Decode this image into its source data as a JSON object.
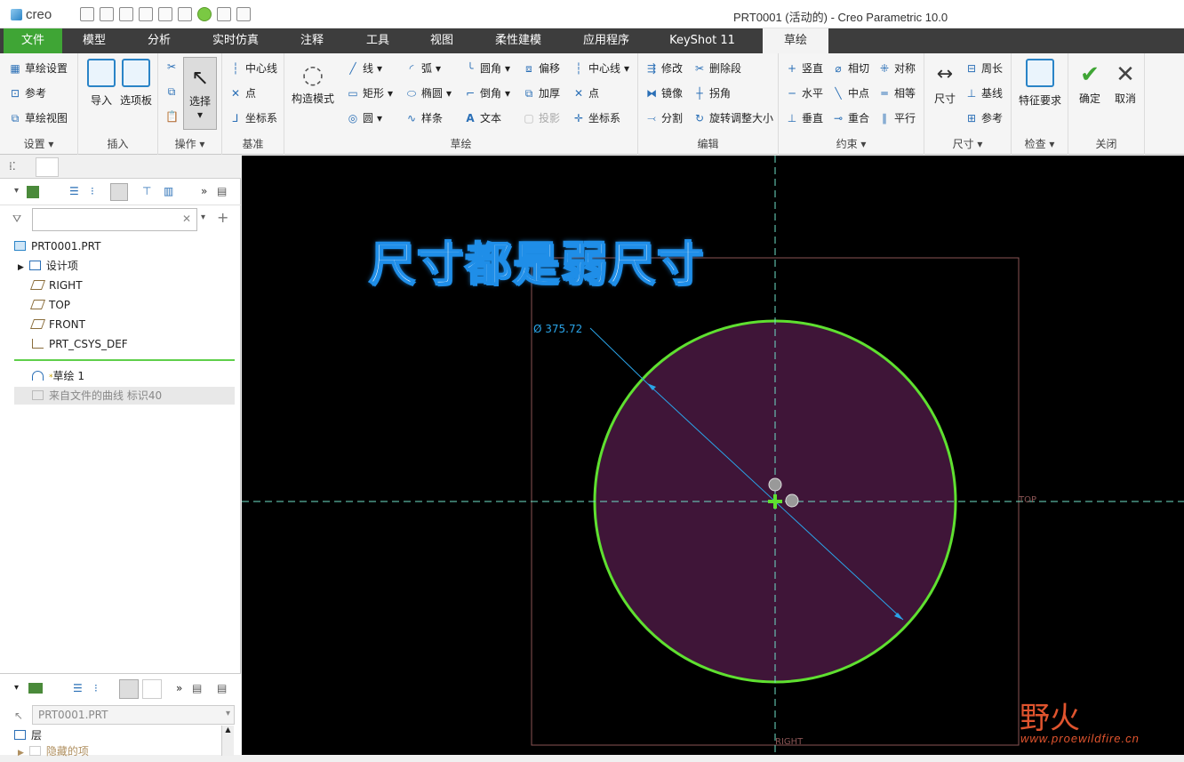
{
  "app": {
    "logo_text": "creo",
    "window_title": "PRT0001 (活动的) - Creo Parametric 10.0"
  },
  "tabs": [
    {
      "label": "文件"
    },
    {
      "label": "模型"
    },
    {
      "label": "分析"
    },
    {
      "label": "实时仿真"
    },
    {
      "label": "注释"
    },
    {
      "label": "工具"
    },
    {
      "label": "视图"
    },
    {
      "label": "柔性建模"
    },
    {
      "label": "应用程序"
    },
    {
      "label": "KeyShot 11"
    },
    {
      "label": "草绘"
    }
  ],
  "ribbon": {
    "setup": {
      "items": [
        "草绘设置",
        "参考",
        "草绘视图"
      ],
      "label": "设置"
    },
    "insert": {
      "items": [
        "导入",
        "选项板"
      ],
      "label": "插入"
    },
    "operations": {
      "select": "选择",
      "label": "操作"
    },
    "datum": {
      "items": [
        "中心线",
        "点",
        "坐标系"
      ],
      "label": "基准"
    },
    "sketch": {
      "construction_mode": "构造模式",
      "col1": [
        "线",
        "矩形",
        "圆"
      ],
      "col2": [
        "弧",
        "椭圆",
        "样条"
      ],
      "col3": [
        "圆角",
        "倒角",
        "文本"
      ],
      "col4": [
        "偏移",
        "加厚",
        "投影"
      ],
      "col5": [
        "中心线",
        "点",
        "坐标系"
      ],
      "label": "草绘"
    },
    "edit": {
      "items": [
        "修改",
        "删除段",
        "镜像",
        "拐角",
        "分割",
        "旋转调整大小"
      ],
      "label": "编辑"
    },
    "constrain": {
      "items": [
        "竖直",
        "相切",
        "对称",
        "水平",
        "中点",
        "相等",
        "垂直",
        "重合",
        "平行"
      ],
      "label": "约束"
    },
    "dimension": {
      "big": "尺寸",
      "items": [
        "周长",
        "基线",
        "参考"
      ],
      "label": "尺寸"
    },
    "inspect": {
      "big": "特征要求",
      "label": "检查"
    },
    "close": {
      "ok": "确定",
      "cancel": "取消",
      "label": "关闭"
    }
  },
  "model_tree": {
    "root": "PRT0001.PRT",
    "items": [
      "设计项",
      "RIGHT",
      "TOP",
      "FRONT",
      "PRT_CSYS_DEF"
    ],
    "sketch": "草绘 1",
    "curve": "来自文件的曲线 标识40"
  },
  "layer_panel": {
    "selector": "PRT0001.PRT",
    "layers_label": "层",
    "hidden_label": "隐藏的项"
  },
  "graphics": {
    "overlay_text": "尺寸都是弱尺寸",
    "dimension_label": "Ø 375.72",
    "top_label": "TOP",
    "right_label": "RIGHT",
    "watermark_cn": "野火",
    "watermark_url": "www.proewildfire.cn",
    "colors": {
      "circle": "#5fe030",
      "fill": "#3f1538",
      "dim": "#2aa4e8",
      "axis": "#6fe0c8",
      "frame": "#8a5555"
    }
  }
}
